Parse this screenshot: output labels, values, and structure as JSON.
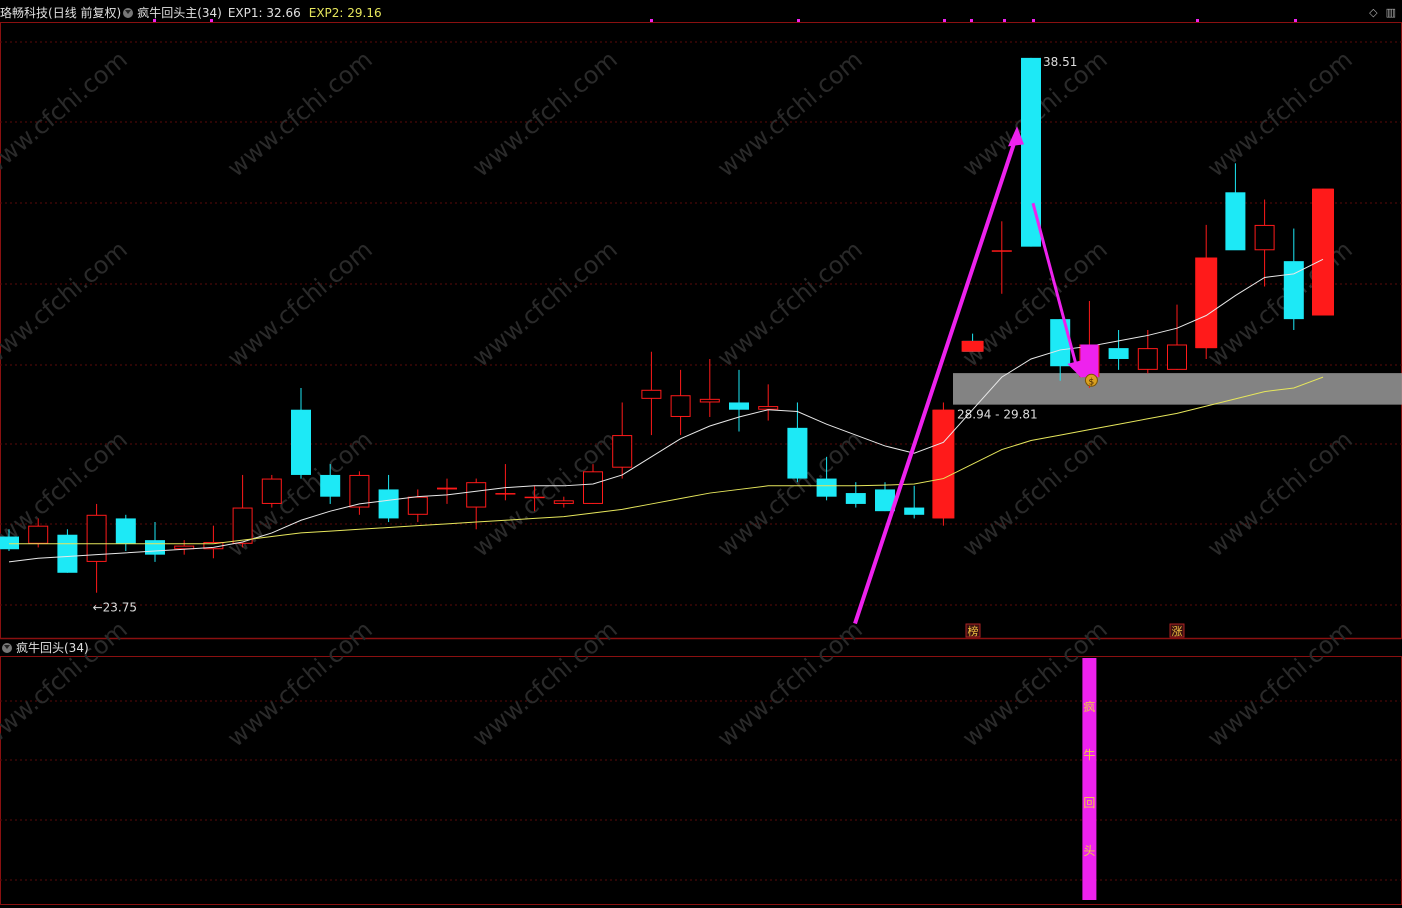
{
  "header": {
    "stock_name": "珞畅科技",
    "period": "(日线 前复权)",
    "indicator_name": "疯牛回头主(34)",
    "exp1_label": "EXP1: 32.66",
    "exp2_label": "EXP2: 29.16"
  },
  "subpanel": {
    "title": "疯牛回头(34)",
    "signal_chars": [
      "疯",
      "牛",
      "回",
      "头"
    ]
  },
  "annotations": {
    "high_label": "38.51",
    "low_label": "←23.75",
    "zone_label": "28.94 - 29.81",
    "tag_bang": "榜",
    "tag_zhang": "涨",
    "coin_icon": "$"
  },
  "watermark": "www.cfchi.com",
  "colors": {
    "up": "#ff1a1a",
    "down": "#1de9f6",
    "ma_white": "#e8e8e8",
    "ma_yellow": "#e6e65c",
    "signal": "#ee22ee",
    "zone": "#9a9a9a",
    "grid": "#5a0a0a",
    "divider": "#8a1010",
    "header_exp1": "#e0e0e0",
    "header_exp2": "#e6e65c"
  },
  "chart_data": {
    "type": "candlestick",
    "ylim": [
      22.5,
      39.5
    ],
    "candles": [
      {
        "o": 25.3,
        "h": 25.5,
        "l": 24.9,
        "c": 24.95
      },
      {
        "o": 25.1,
        "h": 25.8,
        "l": 25.0,
        "c": 25.6
      },
      {
        "o": 25.35,
        "h": 25.5,
        "l": 24.3,
        "c": 24.3
      },
      {
        "o": 24.6,
        "h": 26.2,
        "l": 23.75,
        "c": 25.9
      },
      {
        "o": 25.8,
        "h": 25.9,
        "l": 24.9,
        "c": 25.1
      },
      {
        "o": 25.2,
        "h": 25.7,
        "l": 24.6,
        "c": 24.8
      },
      {
        "o": 24.95,
        "h": 25.2,
        "l": 24.8,
        "c": 25.05
      },
      {
        "o": 24.95,
        "h": 25.6,
        "l": 24.7,
        "c": 25.15
      },
      {
        "o": 25.1,
        "h": 27.0,
        "l": 25.0,
        "c": 26.1
      },
      {
        "o": 26.2,
        "h": 27.0,
        "l": 26.1,
        "c": 26.9
      },
      {
        "o": 28.8,
        "h": 29.4,
        "l": 26.9,
        "c": 27.0
      },
      {
        "o": 27.0,
        "h": 27.3,
        "l": 26.2,
        "c": 26.4
      },
      {
        "o": 26.1,
        "h": 27.1,
        "l": 25.9,
        "c": 27.0
      },
      {
        "o": 26.6,
        "h": 27.0,
        "l": 25.7,
        "c": 25.8
      },
      {
        "o": 25.9,
        "h": 26.6,
        "l": 25.7,
        "c": 26.4
      },
      {
        "o": 26.6,
        "h": 26.9,
        "l": 26.2,
        "c": 26.65
      },
      {
        "o": 26.1,
        "h": 26.9,
        "l": 25.5,
        "c": 26.8
      },
      {
        "o": 26.5,
        "h": 27.3,
        "l": 26.3,
        "c": 26.5
      },
      {
        "o": 26.4,
        "h": 26.7,
        "l": 26.0,
        "c": 26.4
      },
      {
        "o": 26.2,
        "h": 26.4,
        "l": 26.1,
        "c": 26.3
      },
      {
        "o": 26.2,
        "h": 27.3,
        "l": 26.2,
        "c": 27.1
      },
      {
        "o": 27.2,
        "h": 29.0,
        "l": 26.9,
        "c": 28.1
      },
      {
        "o": 29.1,
        "h": 30.4,
        "l": 28.1,
        "c": 29.35
      },
      {
        "o": 28.6,
        "h": 29.9,
        "l": 28.1,
        "c": 29.2
      },
      {
        "o": 29.0,
        "h": 30.2,
        "l": 28.6,
        "c": 29.1
      },
      {
        "o": 29.0,
        "h": 29.9,
        "l": 28.2,
        "c": 28.8
      },
      {
        "o": 28.8,
        "h": 29.5,
        "l": 28.5,
        "c": 28.9
      },
      {
        "o": 28.3,
        "h": 29.0,
        "l": 26.8,
        "c": 26.9
      },
      {
        "o": 26.9,
        "h": 27.5,
        "l": 26.3,
        "c": 26.4
      },
      {
        "o": 26.5,
        "h": 26.8,
        "l": 26.1,
        "c": 26.2
      },
      {
        "o": 26.6,
        "h": 26.8,
        "l": 26.0,
        "c": 26.0
      },
      {
        "o": 26.1,
        "h": 26.7,
        "l": 25.8,
        "c": 25.9
      },
      {
        "o": 25.8,
        "h": 29.0,
        "l": 25.6,
        "c": 28.8
      },
      {
        "o": 30.7,
        "h": 30.9,
        "l": 30.4,
        "c": 30.4
      },
      {
        "o": 33.2,
        "h": 34.0,
        "l": 32.0,
        "c": 33.2
      },
      {
        "o": 38.51,
        "h": 38.51,
        "l": 33.3,
        "c": 33.3
      },
      {
        "o": 31.3,
        "h": 31.3,
        "l": 29.6,
        "c": 30.0
      },
      {
        "o": 29.7,
        "h": 31.8,
        "l": 29.4,
        "c": 30.6
      },
      {
        "o": 30.5,
        "h": 31.0,
        "l": 29.9,
        "c": 30.2
      },
      {
        "o": 29.9,
        "h": 31.0,
        "l": 29.8,
        "c": 30.5
      },
      {
        "o": 29.9,
        "h": 31.7,
        "l": 29.9,
        "c": 30.6
      },
      {
        "o": 30.5,
        "h": 33.9,
        "l": 30.2,
        "c": 33.0
      },
      {
        "o": 34.8,
        "h": 35.6,
        "l": 33.5,
        "c": 33.2
      },
      {
        "o": 33.2,
        "h": 34.6,
        "l": 32.2,
        "c": 33.9
      },
      {
        "o": 32.9,
        "h": 33.8,
        "l": 31.0,
        "c": 31.3
      },
      {
        "o": 31.4,
        "h": 34.9,
        "l": 31.4,
        "c": 34.9
      }
    ],
    "ma_white": [
      24.6,
      24.7,
      24.75,
      24.8,
      24.85,
      24.9,
      24.95,
      25.0,
      25.15,
      25.4,
      25.75,
      26.0,
      26.2,
      26.3,
      26.4,
      26.45,
      26.55,
      26.65,
      26.7,
      26.7,
      26.75,
      27.0,
      27.5,
      28.0,
      28.35,
      28.6,
      28.8,
      28.75,
      28.4,
      28.1,
      27.8,
      27.6,
      27.9,
      28.8,
      29.7,
      30.2,
      30.45,
      30.55,
      30.7,
      30.85,
      31.05,
      31.4,
      31.95,
      32.45,
      32.55,
      32.95
    ],
    "ma_yellow": [
      25.1,
      25.1,
      25.1,
      25.1,
      25.1,
      25.1,
      25.1,
      25.1,
      25.2,
      25.3,
      25.4,
      25.45,
      25.5,
      25.55,
      25.6,
      25.65,
      25.7,
      25.75,
      25.8,
      25.85,
      25.95,
      26.05,
      26.2,
      26.35,
      26.5,
      26.6,
      26.7,
      26.7,
      26.7,
      26.7,
      26.72,
      26.75,
      26.9,
      27.3,
      27.7,
      27.95,
      28.1,
      28.25,
      28.4,
      28.55,
      28.7,
      28.9,
      29.1,
      29.3,
      29.4,
      29.7
    ],
    "zone": [
      28.94,
      29.81
    ],
    "signal_bar_index": 37
  }
}
